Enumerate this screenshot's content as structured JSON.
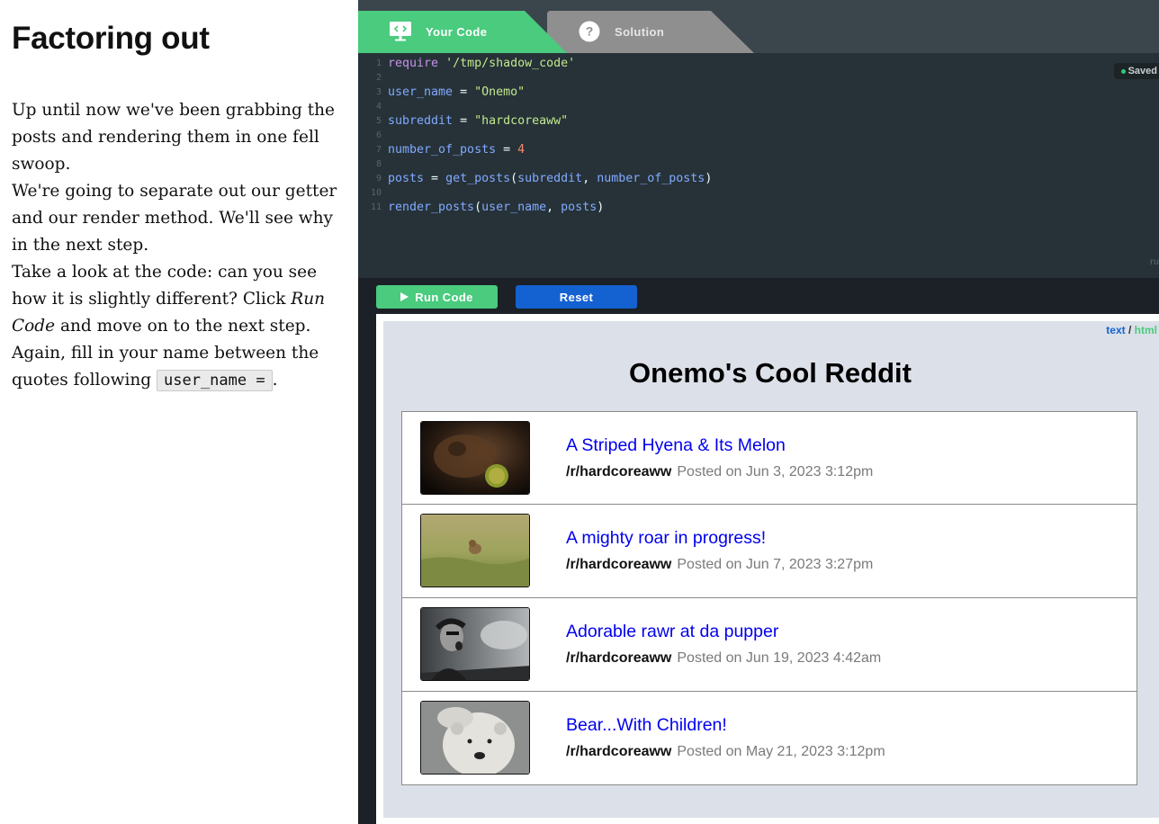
{
  "lesson": {
    "title": "Factoring out",
    "p1": "Up until now we've been grabbing the posts and rendering them in one fell swoop.",
    "p2": "We're going to separate out our getter and our render method. We'll see why in the next step.",
    "p3_before": "Take a look at the code: can you see how it is slightly different? Click ",
    "p3_em": "Run Code",
    "p3_middle": " and move on to the next step. Again, fill in your name between the quotes following ",
    "p3_code": "user_name =",
    "p3_after": "."
  },
  "tabs": {
    "code": {
      "label": "Your Code",
      "icon": "monitor-code-icon"
    },
    "solution": {
      "label": "Solution",
      "icon": "question-circle-icon"
    }
  },
  "editor": {
    "saved": "Saved",
    "runtime_stub": "ru",
    "line_numbers": [
      "1",
      "2",
      "3",
      "4",
      "5",
      "6",
      "7",
      "8",
      "9",
      "10",
      "11"
    ]
  },
  "code_tokens": {
    "l1": {
      "kw": "require",
      "str": "'/tmp/shadow_code'"
    },
    "l3": {
      "var": "user_name",
      "op": " = ",
      "str": "\"Onemo\""
    },
    "l5": {
      "var": "subreddit",
      "op": " = ",
      "str": "\"hardcoreaww\""
    },
    "l7": {
      "var": "number_of_posts",
      "op": " = ",
      "num": "4"
    },
    "l9": {
      "var": "posts",
      "op": " = ",
      "fn": "get_posts",
      "p1": "(",
      "a1": "subreddit",
      "c": ", ",
      "a2": "number_of_posts",
      "p2": ")"
    },
    "l11": {
      "fn": "render_posts",
      "p1": "(",
      "a1": "user_name",
      "c": ", ",
      "a2": "posts",
      "p2": ")"
    }
  },
  "toolbar": {
    "run_label": "Run Code",
    "reset_label": "Reset"
  },
  "output": {
    "toggle_text": "text",
    "toggle_sep": " / ",
    "toggle_html": "html",
    "title": "Onemo's Cool Reddit",
    "posts": [
      {
        "title": "A Striped Hyena & Its Melon",
        "subreddit": "/r/hardcoreaww",
        "date": "Posted on Jun 3, 2023 3:12pm",
        "thumb": "hyena-photo"
      },
      {
        "title": "A mighty roar in progress!",
        "subreddit": "/r/hardcoreaww",
        "date": "Posted on Jun 7, 2023 3:27pm",
        "thumb": "cub-in-grass-photo"
      },
      {
        "title": "Adorable rawr at da pupper",
        "subreddit": "/r/hardcoreaww",
        "date": "Posted on Jun 19, 2023 4:42am",
        "thumb": "screaming-man-photo"
      },
      {
        "title": "Bear...With Children!",
        "subreddit": "/r/hardcoreaww",
        "date": "Posted on May 21, 2023 3:12pm",
        "thumb": "polar-bear-photo"
      }
    ]
  },
  "colors": {
    "tab_active": "#4acb7e",
    "tab_inactive": "#8f8f8f",
    "run_button": "#4acb7e",
    "reset_button": "#1461d1",
    "editor_bg": "#263238",
    "link": "#0000ee"
  }
}
